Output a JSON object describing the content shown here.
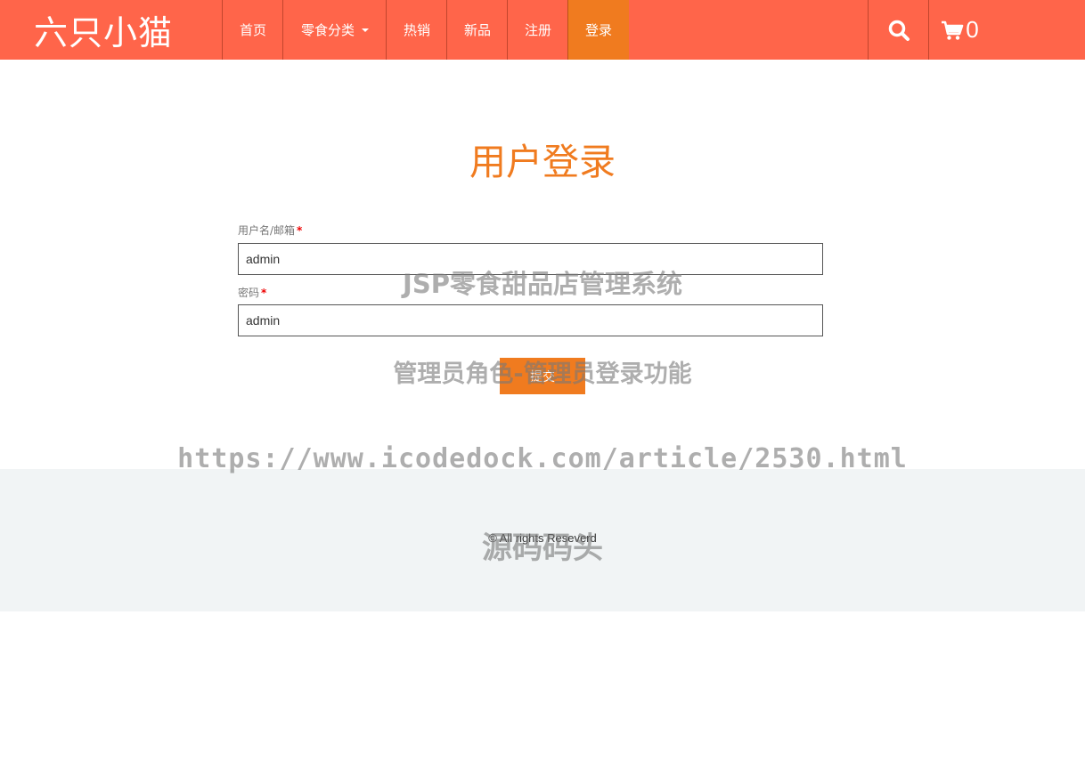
{
  "header": {
    "brand": "六只小猫",
    "nav": [
      {
        "label": "首页"
      },
      {
        "label": "零食分类"
      },
      {
        "label": "热销"
      },
      {
        "label": "新品"
      },
      {
        "label": "注册"
      },
      {
        "label": "登录"
      }
    ],
    "cart_count": "0",
    "icons": {
      "search": "search-icon",
      "cart": "cart-icon",
      "dropdown": "caret-down-icon"
    },
    "colors": {
      "navbar": "#ff654a",
      "active": "#f07b1f"
    }
  },
  "login": {
    "title": "用户登录",
    "username_label": "用户名/邮箱",
    "username_required": "*",
    "username_value": "admin",
    "password_label": "密码",
    "password_required": "*",
    "password_value": "admin",
    "submit_label": "提交"
  },
  "footer": {
    "copyright": "© All rights Reseverd"
  },
  "watermark": {
    "line1": "JSP零食甜品店管理系统",
    "line2": "管理员角色-管理员登录功能",
    "line3": "https://www.icodedock.com/article/2530.html",
    "line4": "源码码头"
  }
}
